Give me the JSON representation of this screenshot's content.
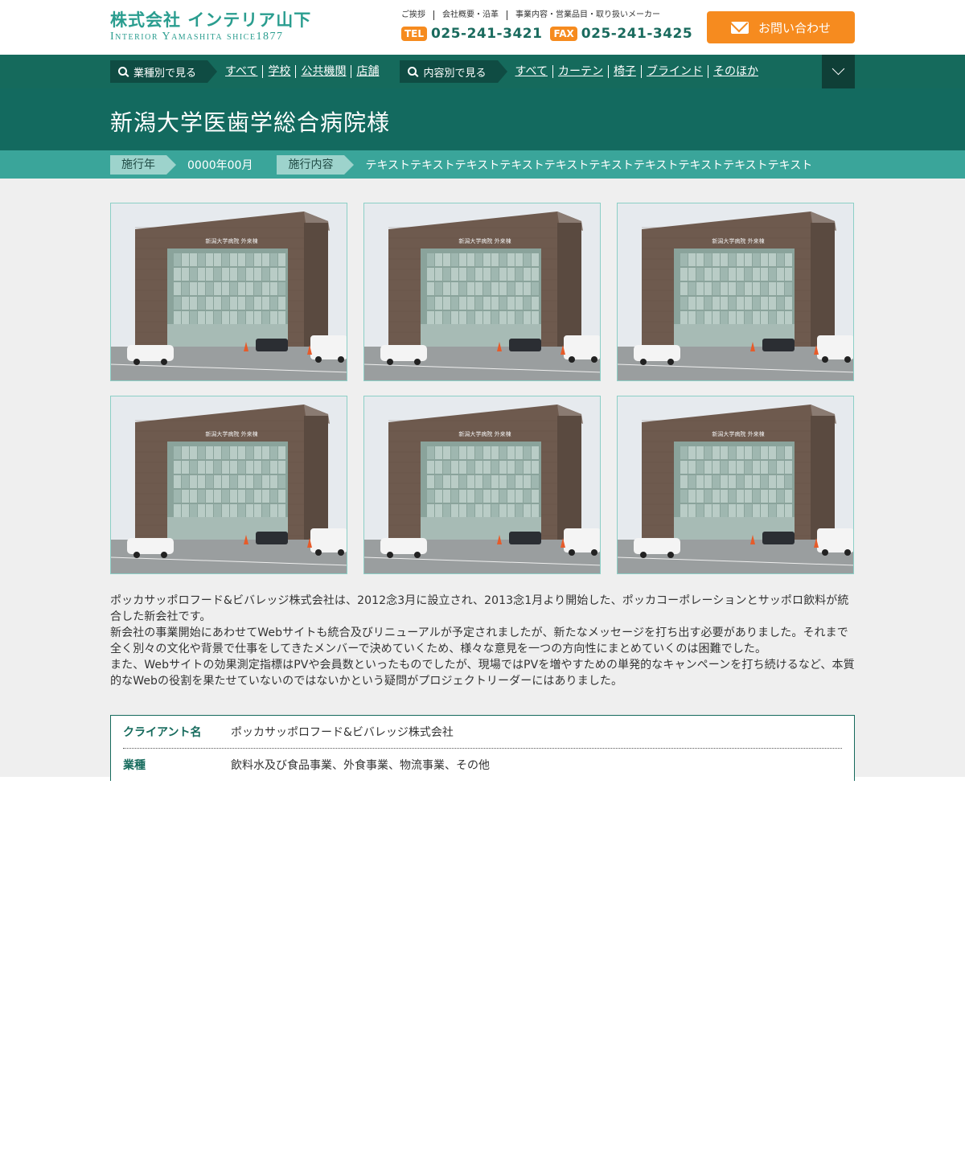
{
  "header": {
    "logo_main": "株式会社 インテリア山下",
    "logo_sub": "Interior Yamashita shice1877",
    "top_links": [
      "ご挨拶",
      "会社概要・沿革",
      "事業内容・営業品目・取り扱いメーカー"
    ],
    "tel_label": "TEL",
    "tel_number": "025-241-3421",
    "fax_label": "FAX",
    "fax_number": "025-241-3425",
    "contact_label": "お問い合わせ"
  },
  "nav": {
    "industry_label": "業種別で見る",
    "industry_links": [
      "すべて",
      "学校",
      "公共機関",
      "店舗"
    ],
    "content_label": "内容別で見る",
    "content_links": [
      "すべて",
      "カーテン",
      "椅子",
      "ブラインド",
      "そのほか"
    ]
  },
  "page": {
    "title": "新潟大学医歯学総合病院様"
  },
  "info": {
    "year_label": "施行年",
    "year_value": "0000年00月",
    "content_label": "施行内容",
    "content_value": "テキストテキストテキストテキストテキストテキストテキストテキストテキストテキスト"
  },
  "gallery": {
    "building_sign": "新潟大学病院 外来棟",
    "count": 6
  },
  "description": [
    "ポッカサッポロフード&ビバレッジ株式会社は、2012念3月に設立され、2013念1月より開始した、ポッカコーポレーションとサッポロ飲料が統合した新会社です。",
    "新会社の事業開始にあわせてWebサイトも統合及びリニューアルが予定されましたが、新たなメッセージを打ち出す必要がありました。それまで全く別々の文化や背景で仕事をしてきたメンバーで決めていくため、様々な意見を一つの方向性にまとめていくのは困難でした。",
    "また、Webサイトの効果測定指標はPVや会員数といったものでしたが、現場ではPVを増やすための単発的なキャンペーンを打ち続けるなど、本質的なWebの役割を果たせていないのではないかという疑問がプロジェクトリーダーにはありました。"
  ],
  "details": {
    "client_label": "クライアント名",
    "client_value": "ポッカサッポロフード&ビバレッジ株式会社",
    "industry_label": "業種",
    "industry_value": "飲料水及び食品事業、外食事業、物流事業、その他"
  },
  "colors": {
    "brand_teal": "#156a5c",
    "accent_orange": "#f68b1f",
    "info_bar": "#3aa59a"
  }
}
